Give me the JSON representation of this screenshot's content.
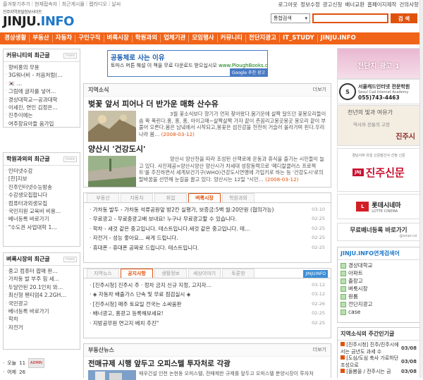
{
  "top": {
    "left_links": [
      "즐겨찾기추가",
      "현재접속자",
      "최근게시물",
      "랩라디오",
      "날씨"
    ],
    "right_links": [
      "로그아웃",
      "정보수정",
      "광고신청",
      "배너교환",
      "홈페이지제작",
      "건의사항"
    ],
    "logo_small": "진주지역포털정보사이트",
    "logo_jinju": "JINJU.",
    "logo_info": "INFO"
  },
  "search": {
    "select": "통합검색",
    "button": "검 색"
  },
  "nav": [
    "경상생활",
    "부동산",
    "자동차",
    "구인구직",
    "벼룩시장",
    "학원과외",
    "업체기관",
    "모임행사",
    "커뮤니티",
    "전단지광고",
    "IT_STUDY",
    "JINJU.INFO"
  ],
  "left": {
    "community": {
      "title": "커뮤니티의 최근글",
      "items": [
        "향비홍의 무용",
        "3G워너비 - 처음처럼(…",
        "🇰🇷 …",
        "그림에 글자를 넣어…",
        "경상대학교—공과대학",
        "이세진, 연인 김정은…",
        "진주이에는",
        "여주장요아들 움가입"
      ]
    },
    "academy": {
      "title": "학원과외의 최근글",
      "items": [
        "인터넷수강",
        "[한]지보",
        "진주인터넷수능방송",
        "수강생모집합니다",
        "컴퓨터과외생모집",
        "국민지원 교육비 비용…",
        "베너등록 바로가기",
        "\"수도권 사업대학 1…"
      ]
    },
    "flea": {
      "title": "벼룩시장의 최근글",
      "items": [
        "중고 컴퓨터 팝매 판…",
        "가차동 발 부주 힘 세…",
        "두달안된 20.1인치 와…",
        "최신형 펜티엄4 2.2GH…",
        "국민광고",
        "베너등록 바로가기",
        "학차",
        "자전거"
      ]
    },
    "stats": [
      {
        "label": "오늘",
        "value": "11",
        "badge": "ADMIN"
      },
      {
        "label": "어제",
        "value": "26",
        "badge": ""
      }
    ]
  },
  "ad": {
    "title": "공동체로 사는 이유",
    "desc": "토마스 머튼 해설 이 책을 무료 다운로드 받으십시오",
    "url": "www.PloughBooks.co.uk",
    "google": "Google 추천 광고"
  },
  "local_news": {
    "title": "지역소식",
    "more": "더보기",
    "items": [
      {
        "headline": "벚꽃 앞서 피어나 더 반가운 매화 산수유",
        "body": "3월 꽃소식보다 향기가 먼저 찾아왔다.봄기운에 살짝 달뜨던 꽃봉오리들이 솜 꽉 폭린다.홍, 홍, 홍, 아이고매~살짝살짝 가자 끝이 촌꼼리고봉곳봉곳 봉오리 끝이 부풀어 오른다.봄은 남녘에서 시작되고,봉꽃은 섬진강을 천천히 거슬러 올라가며 핀다.우리나라 봄…",
        "date": "(2008-03-12)"
      },
      {
        "headline": "양산시 '건강도시'",
        "body": "양산시 양산천을 따라 조성된 산책로에 운동과 휴식을 즐기는 시민들이 늘고 있다. 사진제공=양산시양산 양산시가 차세대 성장동력으로 '메디칼클러스 프로젝트'를 추진하면서 세계보건기구(WHO)건강도시연맹에 가입키로 하는 등 '건강도시'로의 탈바꿈을 선언해 눈길을 끌고 있다. 양산시는 12일 \"시민…",
        "date": "(2008-03-12)"
      }
    ]
  },
  "board_tabs": {
    "tabs": [
      "부동산",
      "자동차",
      "취업",
      "벼룩시장",
      "학원과외"
    ],
    "active": 3,
    "rows": [
      {
        "text": "가차동 발두 - 가차동 석류공원앞 방2칸 실평가, 보증금:5백 월:20만원 (협의가능)",
        "date": "03-10"
      },
      {
        "text": "무료광고 - 무료중광고배 보내요! 누구나 무료광고할 수 있습니다.",
        "date": "02-25"
      },
      {
        "text": "학차 - 새것 같은 중고입니다. 테스트입니다.새것 같은 중고입니다. 테…",
        "date": "02-25"
      },
      {
        "text": "자전거 - 성능 좋아요... 싸게 드립니다.",
        "date": "02-25"
      },
      {
        "text": "휴대폰 - 휴대폰 공짜로 드립니다. 테스트입니다.",
        "date": "02-25"
      }
    ]
  },
  "notice_tabs": {
    "tabs": [
      "지역뉴스",
      "공지사항",
      "생활정보",
      "세상이야기",
      "토론방"
    ],
    "active": 1,
    "tag": "JINJUINFO",
    "rows": [
      {
        "text": "[진주시청] 진주시 주 · 정차 금지 신규 지정, 고지자…",
        "date": "03-12"
      },
      {
        "text": "◈ 자동차 배출가스 단속 및 무료 점검실시 ◈",
        "date": "03-12"
      },
      {
        "text": "[진주시청] 매주 토요일 전국는 소싸움판",
        "date": "02-26"
      },
      {
        "text": "배너광고, 홍광고 등록해보세요!",
        "date": "02-25"
      },
      {
        "text": "지방공무원 연고지 배치 추진\"",
        "date": "02-25"
      }
    ]
  },
  "realestate": {
    "title": "부동산뉴스",
    "more": "더보기",
    "headline": "전매규제 시행 앞두고 오피스텔 투자처로 각광",
    "body": "매우건설 인천 논현동 오피스텔, 전매제한 규제를 앞두고 오피스텔 분양시장이 투자처"
  },
  "right": {
    "ad1": "전단지 광고 1",
    "ad2_title": "서울캐드인터넷 전문학원",
    "ad2_sub": "Seoul Cad Internet Academy",
    "ad2_phone": "055)743-4463",
    "ad3_line1": "천년의 빛과 여유가",
    "ad3_line2": "역사와 전통의 고장",
    "ad3_brand": "진주시",
    "ad4_small": "경남서부 유일 신문발간사 선정 신문",
    "ad4_brand": "진주신문",
    "ad5_brand": "롯데시네마",
    "ad5_sub": "LOTTE CINEMA",
    "banner_title": "무료배너등록 바로가기",
    "banner_sub": "@smer.cd",
    "link_box": {
      "title": "JINJU.INFO연계검색어",
      "items": [
        "경상대학교",
        "아파트",
        "출장고",
        "벼룩시장",
        "원룸",
        "전단지광고",
        "case"
      ]
    },
    "weekly": {
      "title": "지역소식의 주간인기글",
      "items": [
        {
          "text": "[진주시청] 진주/진주시에서는 금년도 과세 수",
          "date": "03/08"
        },
        {
          "text": "[도심/도심 축사 가로하단 조성으로",
          "date": "03/08"
        },
        {
          "text": "[돌봄을 / 전주시는 금",
          "date": "03/08"
        }
      ]
    }
  }
}
